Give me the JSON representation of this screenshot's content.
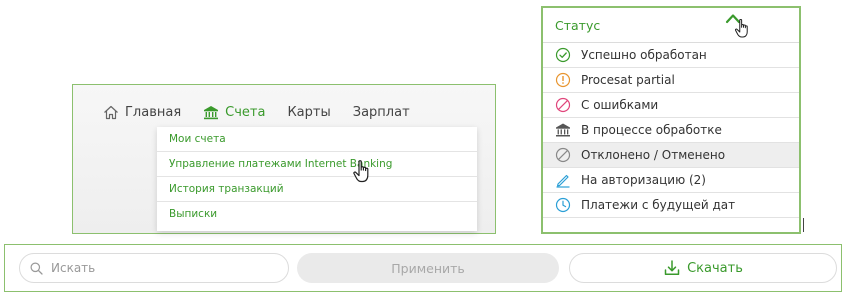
{
  "colors": {
    "accent_green": "#3a9a2c",
    "border_green": "#8cc06e",
    "error_pink": "#e0457b",
    "warning_orange": "#e8952f",
    "info_blue": "#2a9fd6"
  },
  "nav": {
    "items": [
      {
        "label": "Главная",
        "icon": "home-icon",
        "active": false
      },
      {
        "label": "Счета",
        "icon": "bank-icon",
        "active": true
      },
      {
        "label": "Карты",
        "icon": null,
        "active": false
      },
      {
        "label": "Зарплат",
        "icon": null,
        "active": false
      }
    ],
    "dropdown": [
      "Мои счета",
      "Управление платежами Internet Banking",
      "История транзакций",
      "Выписки"
    ]
  },
  "status_filter": {
    "title": "Статус",
    "items": [
      {
        "label": "Успешно обработан",
        "icon": "check-circle-icon"
      },
      {
        "label": "Procesat partial",
        "icon": "warning-circle-icon"
      },
      {
        "label": "С ошибками",
        "icon": "prohibited-circle-icon"
      },
      {
        "label": "В процессе обработке",
        "icon": "bank-icon"
      },
      {
        "label": "Отклонено / Отменено",
        "icon": "cancelled-circle-icon"
      },
      {
        "label": "На авторизацию (2)",
        "icon": "pen-icon"
      },
      {
        "label": "Платежи с будущей дат",
        "icon": "clock-icon"
      }
    ]
  },
  "toolbar": {
    "search_placeholder": "Искать",
    "apply_label": "Применить",
    "download_label": "Скачать"
  }
}
